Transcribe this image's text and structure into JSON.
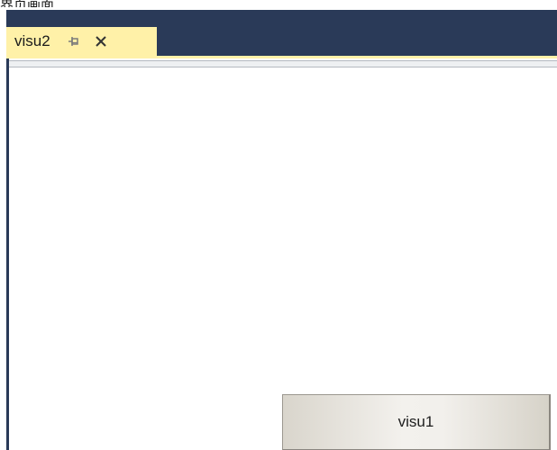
{
  "caption": {
    "text": "界页画面"
  },
  "tab": {
    "title": "visu2",
    "pin_icon": "pin-icon",
    "close_icon": "close-icon"
  },
  "editor": {
    "button_label": "visu1"
  },
  "colors": {
    "ide_background": "#2a3a58",
    "active_tab": "#fff1a8",
    "editor_background": "#ffffff",
    "button_face": "#f2f0ec"
  }
}
